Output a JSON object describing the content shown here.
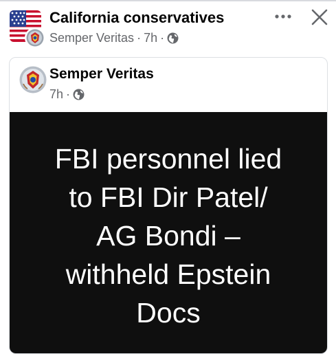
{
  "header": {
    "group_name": "California conservatives",
    "poster_name": "Semper Veritas",
    "separator": "·",
    "time": "7h",
    "audience_icon": "globe-icon",
    "more_icon": "more-horizontal-icon",
    "close_icon": "close-icon"
  },
  "shared_post": {
    "page_name": "Semper Veritas",
    "time": "7h",
    "audience_icon": "globe-icon",
    "image_text_lines": [
      "FBI personnel lied",
      "to FBI Dir Patel/",
      "AG Bondi –",
      "withheld Epstein",
      "Docs"
    ]
  },
  "colors": {
    "primary_text": "#050505",
    "secondary_text": "#65676b",
    "image_background": "#0f0f0f",
    "image_text": "#ffffff"
  }
}
